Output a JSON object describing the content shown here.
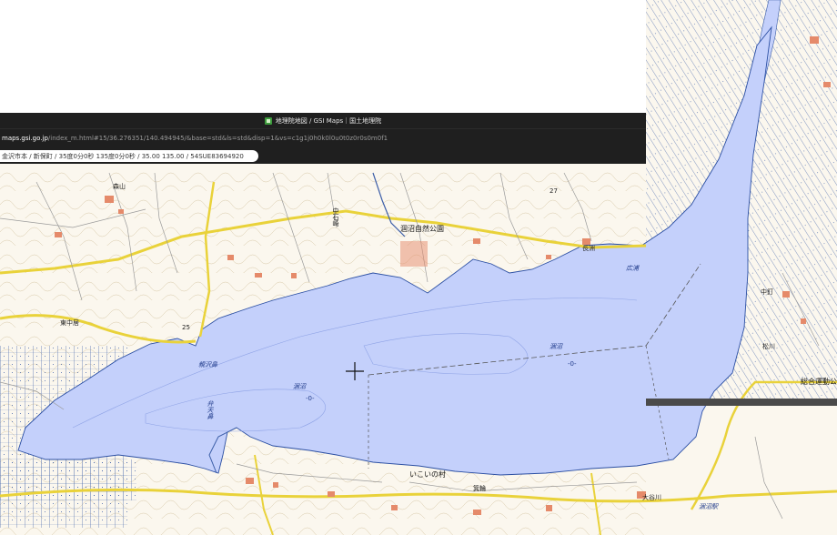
{
  "browser": {
    "window_title": "地理院地図 / GSI Maps｜国土地理院",
    "url_host": "maps.gsi.go.jp",
    "url_path": "/index_m.html#15/36.276351/140.494945/&base=std&ls=std&disp=1&vs=c1g1j0h0k0l0u0t0z0r0s0m0f1",
    "search_text": "金沢市本 / 新保町 / 35度0分0秒 135度0分0秒 / 35.00 135.00 / 54SUE83694920"
  },
  "map": {
    "colors": {
      "water": "#c4d0fb",
      "land": "#fbf7ee",
      "road_major": "#e9d23a",
      "road_minor": "#bdbdbd",
      "contour": "#d6c7a6",
      "paddy_line": "#3d5fa8",
      "building": "#e58a6a"
    },
    "labels": {
      "nakaishi": "中石崎",
      "park": "涸沼自然公園",
      "hirose": "広浦",
      "nagasu": "長洲",
      "oshiga": "親沢鼻",
      "benten": "弁天鼻",
      "hinuma_center": "涸沼",
      "hinuma_east": "涸沼",
      "ikoi": "いこいの村",
      "mino": "箕輪",
      "sports": "総合運動公",
      "depth_center": "-0-",
      "depth_east": "-0-",
      "moriyama": "森山",
      "river_ohara": "大谷川",
      "hinuma_station": "涸沼駅",
      "matsukawa": "松川",
      "kugiyasu": "中釘",
      "higashi": "東中居",
      "elev_1": "25",
      "elev_2": "27"
    },
    "crosshair": "crosshair-icon"
  }
}
